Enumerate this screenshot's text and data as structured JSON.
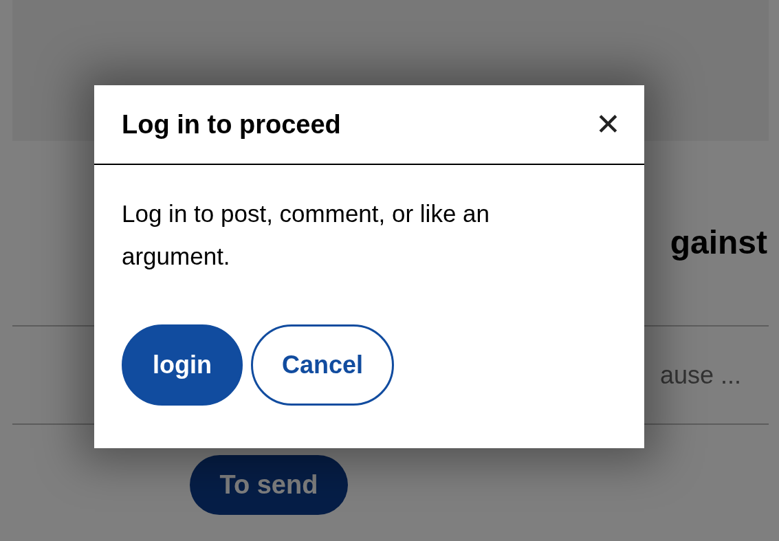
{
  "page": {
    "heading": "gainst",
    "field_placeholder": "ause ...",
    "send_button": "To send"
  },
  "dialog": {
    "title": "Log in to proceed",
    "close": "✕",
    "message": "Log in to post, comment, or like an argument.",
    "buttons": [
      {
        "label": "login",
        "kind": "primary"
      },
      {
        "label": "Cancel",
        "kind": "outline"
      }
    ]
  }
}
